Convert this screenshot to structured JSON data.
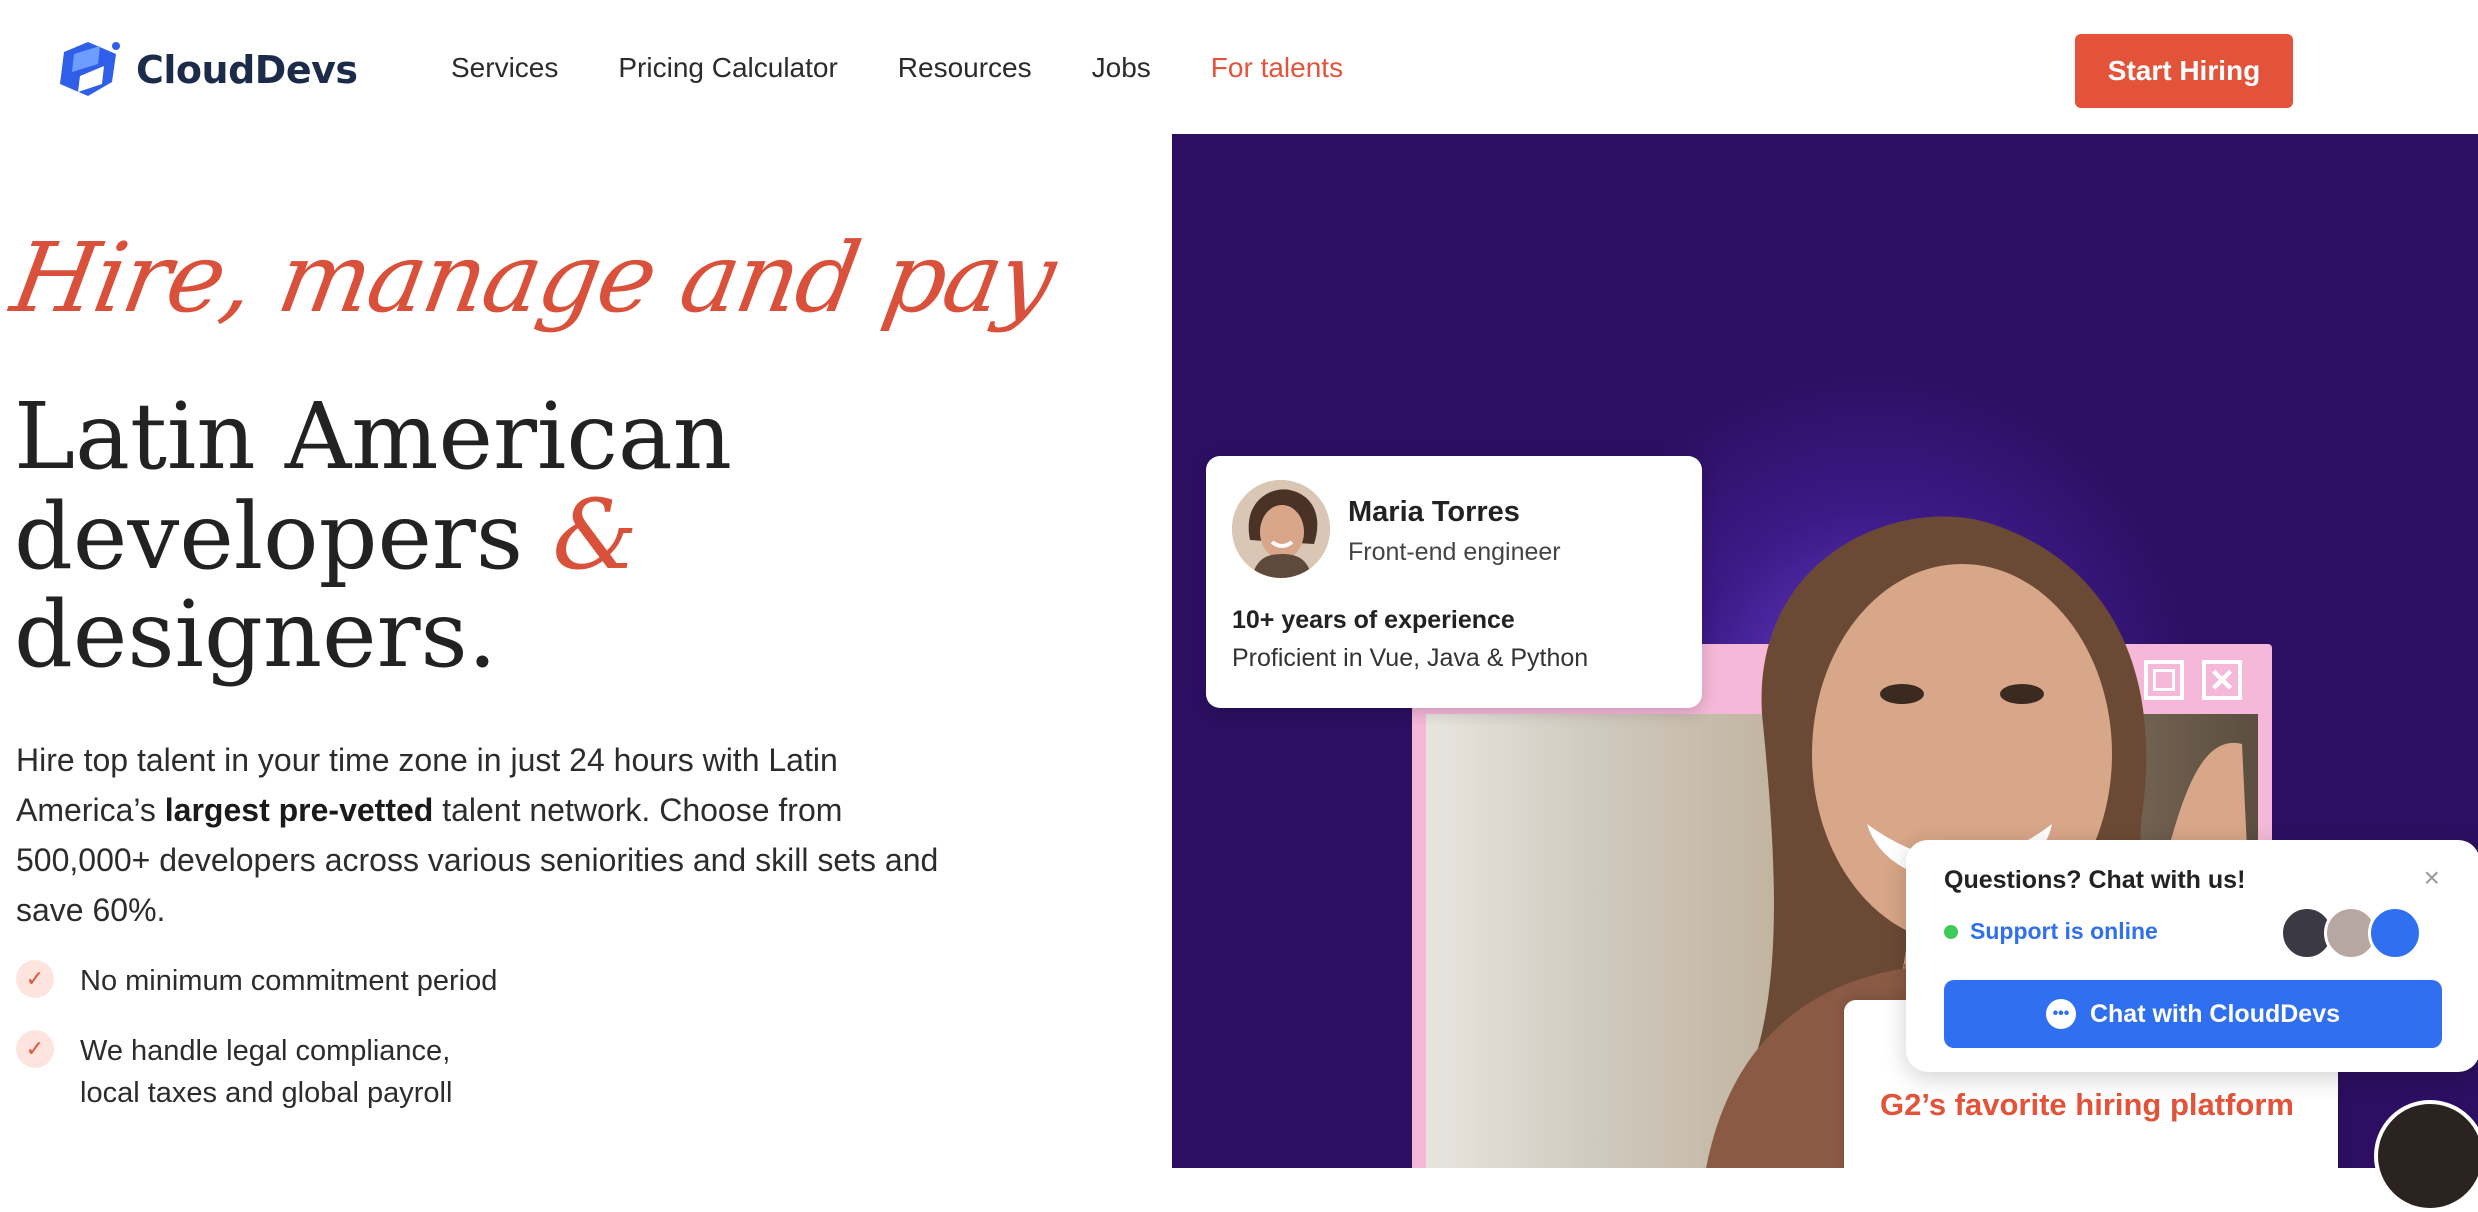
{
  "brand": {
    "name": "CloudDevs",
    "accent": "#e2533a",
    "hero_bg": "#2c0f62"
  },
  "nav": {
    "items": [
      "Services",
      "Pricing Calculator",
      "Resources",
      "Jobs",
      "For talents"
    ],
    "cta": "Start Hiring"
  },
  "hero": {
    "script": "Hire, manage and pay",
    "title_line1": "Latin American",
    "title_line2": "developers",
    "amp": "&",
    "title_line3": "designers.",
    "body_pre": "Hire top talent in your time zone in just 24 hours with Latin America’s ",
    "body_bold": "largest pre-vetted",
    "body_post": " talent network. Choose from 500,000+ developers across various seniorities and skill sets and save 60%.",
    "checks": [
      "No minimum commitment period",
      "We handle legal compliance,\nlocal taxes and global payroll"
    ]
  },
  "profile_card": {
    "name": "Maria Torres",
    "role": "Front-end engineer",
    "experience": "10+ years of experience",
    "skills": "Proficient in Vue, Java & Python"
  },
  "g2": {
    "text": "G2’s favorite hiring platform"
  },
  "chat": {
    "title": "Questions? Chat with us!",
    "close": "×",
    "status": "Support is online",
    "button": "Chat with CloudDevs"
  },
  "icons": [
    "logo-icon",
    "check-icon",
    "window-minimize-icon",
    "window-maximize-icon",
    "window-close-icon",
    "chat-bubble-icon",
    "close-icon"
  ]
}
